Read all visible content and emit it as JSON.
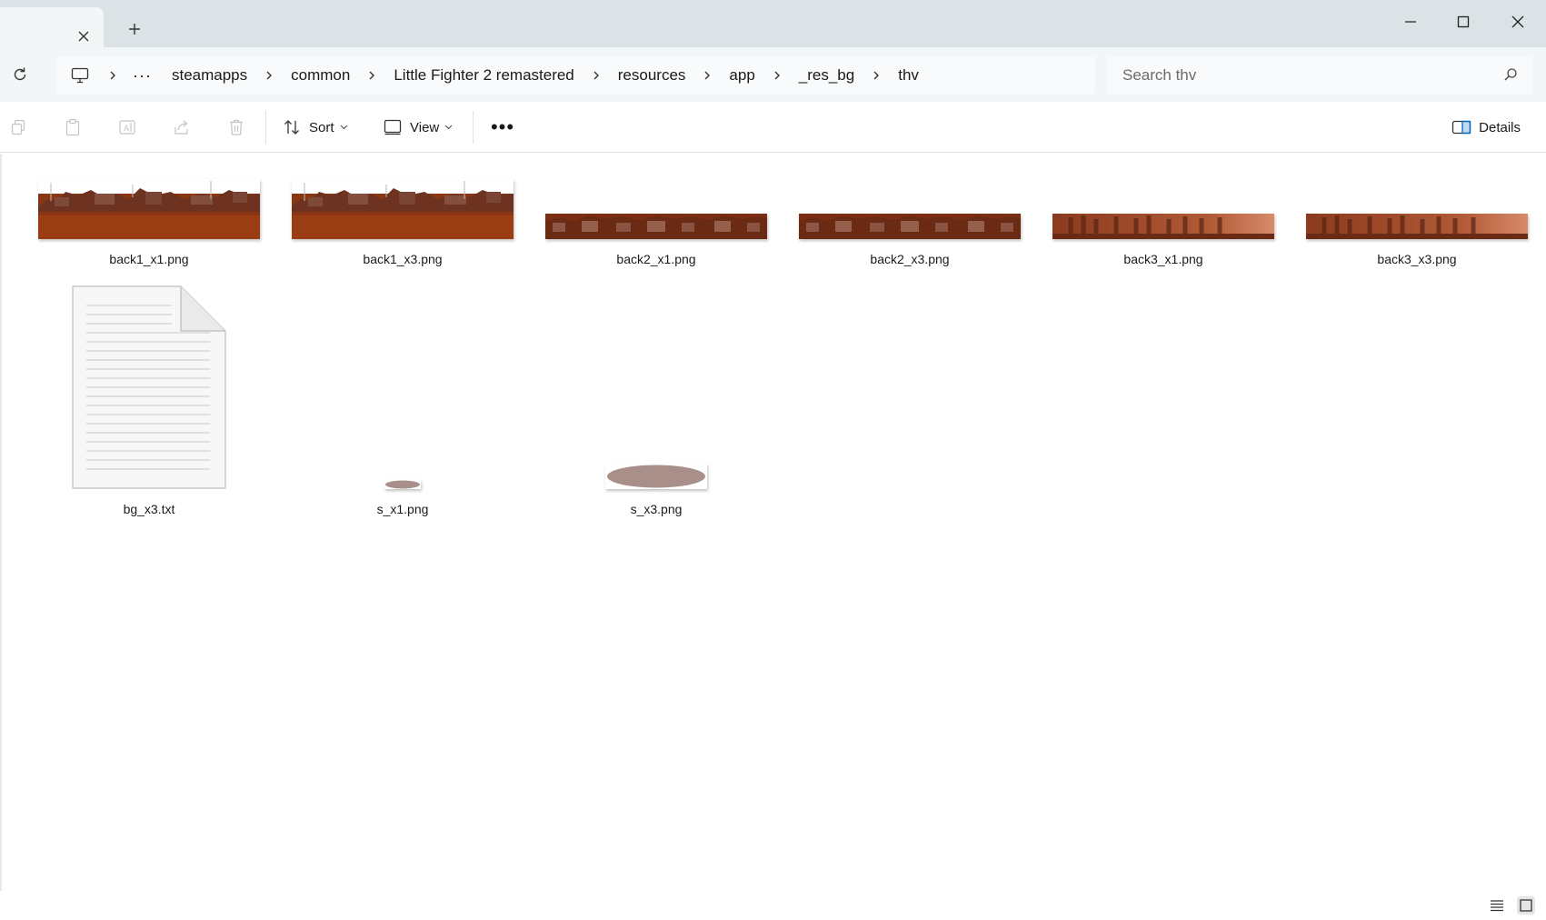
{
  "titlebar": {
    "tab_title": "",
    "new_tab_glyph": "+",
    "minimize_glyph": "—",
    "close_glyph": "✕"
  },
  "address": {
    "overflow_label": "···",
    "crumbs": [
      "steamapps",
      "common",
      "Little Fighter 2 remastered",
      "resources",
      "app",
      "_res_bg",
      "thv"
    ]
  },
  "search": {
    "placeholder": "Search thv"
  },
  "toolbar": {
    "sort_label": "Sort",
    "view_label": "View",
    "more_label": "•••",
    "details_label": "Details"
  },
  "files": [
    {
      "name": "back1_x1.png",
      "kind": "image",
      "thumb": "back1"
    },
    {
      "name": "back1_x3.png",
      "kind": "image",
      "thumb": "back1"
    },
    {
      "name": "back2_x1.png",
      "kind": "image",
      "thumb": "back2"
    },
    {
      "name": "back2_x3.png",
      "kind": "image",
      "thumb": "back2"
    },
    {
      "name": "back3_x1.png",
      "kind": "image",
      "thumb": "back3"
    },
    {
      "name": "back3_x3.png",
      "kind": "image",
      "thumb": "back3"
    },
    {
      "name": "bg_x3.txt",
      "kind": "text",
      "thumb": "document"
    },
    {
      "name": "s_x1.png",
      "kind": "image",
      "thumb": "shadow-small"
    },
    {
      "name": "s_x3.png",
      "kind": "image",
      "thumb": "shadow-large"
    }
  ],
  "colors": {
    "titlebar_bg": "#dbe3e6",
    "address_bg": "#f3f6f7",
    "accent": "#0067c0",
    "thumb_brown": "#8a3a18",
    "shadow_ellipse": "#a88f8a"
  }
}
